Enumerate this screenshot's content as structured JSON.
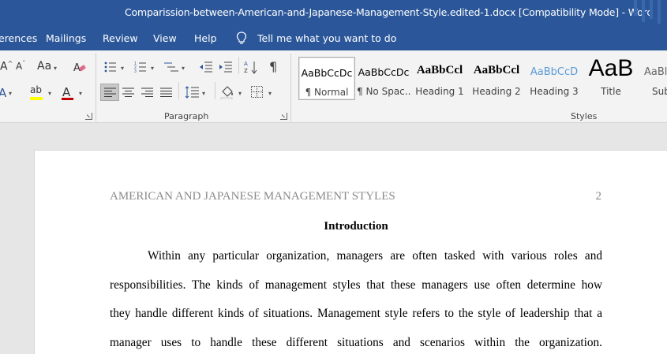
{
  "window": {
    "title": "Comparission-between-American-and-Japanese-Management-Style.edited-1.docx [Compatibility Mode]  -  Word"
  },
  "ribbon_tabs": [
    "erences",
    "Mailings",
    "Review",
    "View",
    "Help"
  ],
  "tell_me": "Tell me what you want to do",
  "ribbon": {
    "font_group": {
      "grow_font": "A^",
      "shrink_font": "Aˇ",
      "change_case": "Aa",
      "text_highlight_color": "#ffff00",
      "font_color": "#c00000"
    },
    "paragraph_label": "Paragraph",
    "styles_label": "Styles",
    "styles": [
      {
        "sample": "AaBbCcDc",
        "name": "¶ Normal"
      },
      {
        "sample": "AaBbCcDc",
        "name": "¶ No Spac..."
      },
      {
        "sample": "AaBbCcl",
        "name": "Heading 1"
      },
      {
        "sample": "AaBbCcl",
        "name": "Heading 2"
      },
      {
        "sample": "AaBbCcD",
        "name": "Heading 3"
      },
      {
        "sample": "AaB",
        "name": "Title"
      },
      {
        "sample": "AaBl",
        "name": "Sub"
      }
    ]
  },
  "document": {
    "running_head": "AMERICAN AND JAPANESE MANAGEMENT STYLES",
    "page_number": "2",
    "heading": "Introduction",
    "lines": [
      "Within any particular organization, managers are often tasked with various roles and",
      "responsibilities. The kinds of management styles that these managers use often determine how",
      "they handle different kinds of situations. Management style refers to the style of leadership that a",
      "manager uses to handle these different situations and scenarios within the organization."
    ]
  }
}
